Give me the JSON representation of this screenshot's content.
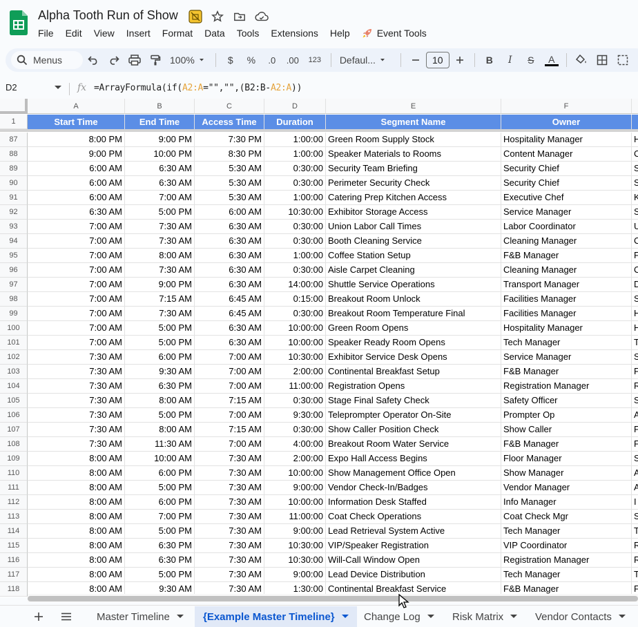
{
  "doc": {
    "title": "Alpha Tooth Run of Show",
    "menus": [
      "File",
      "Edit",
      "View",
      "Insert",
      "Format",
      "Data",
      "Tools",
      "Extensions",
      "Help"
    ],
    "extension_menu": "Event Tools"
  },
  "toolbar": {
    "search_label": "Menus",
    "zoom": "100%",
    "currency": "$",
    "percent": "%",
    "dec_decrease": ".0",
    "dec_increase": ".00",
    "number_format": "123",
    "font": "Defaul...",
    "font_size": "10",
    "bold": "B",
    "italic": "I",
    "strike": "S",
    "text_color": "A"
  },
  "formula_bar": {
    "cell_ref": "D2",
    "fx": "fx",
    "formula_parts": [
      "=ArrayFormula(if(",
      "A2:A",
      "=\"\",\"\",(B2:B-",
      "A2:A",
      "))"
    ]
  },
  "grid": {
    "column_letters": [
      "A",
      "B",
      "C",
      "D",
      "E",
      "F"
    ],
    "header_row_number": "1",
    "headers": [
      "Start Time",
      "End Time",
      "Access Time",
      "Duration",
      "Segment Name",
      "Owner"
    ],
    "rows": [
      {
        "n": "87",
        "a": "8:00 PM",
        "b": "9:00 PM",
        "c": "7:30 PM",
        "d": "1:00:00",
        "e": "Green Room Supply Stock",
        "f": "Hospitality Manager",
        "g": "H"
      },
      {
        "n": "88",
        "a": "9:00 PM",
        "b": "10:00 PM",
        "c": "8:30 PM",
        "d": "1:00:00",
        "e": "Speaker Materials to Rooms",
        "f": "Content Manager",
        "g": "C"
      },
      {
        "n": "89",
        "a": "6:00 AM",
        "b": "6:30 AM",
        "c": "5:30 AM",
        "d": "0:30:00",
        "e": "Security Team Briefing",
        "f": "Security Chief",
        "g": "S"
      },
      {
        "n": "90",
        "a": "6:00 AM",
        "b": "6:30 AM",
        "c": "5:30 AM",
        "d": "0:30:00",
        "e": "Perimeter Security Check",
        "f": "Security Chief",
        "g": "S"
      },
      {
        "n": "91",
        "a": "6:00 AM",
        "b": "7:00 AM",
        "c": "5:30 AM",
        "d": "1:00:00",
        "e": "Catering Prep Kitchen Access",
        "f": "Executive Chef",
        "g": "K"
      },
      {
        "n": "92",
        "a": "6:30 AM",
        "b": "5:00 PM",
        "c": "6:00 AM",
        "d": "10:30:00",
        "e": "Exhibitor Storage Access",
        "f": "Service Manager",
        "g": "S"
      },
      {
        "n": "93",
        "a": "7:00 AM",
        "b": "7:30 AM",
        "c": "6:30 AM",
        "d": "0:30:00",
        "e": "Union Labor Call Times",
        "f": "Labor Coordinator",
        "g": "U"
      },
      {
        "n": "94",
        "a": "7:00 AM",
        "b": "7:30 AM",
        "c": "6:30 AM",
        "d": "0:30:00",
        "e": "Booth Cleaning Service",
        "f": "Cleaning Manager",
        "g": "C"
      },
      {
        "n": "95",
        "a": "7:00 AM",
        "b": "8:00 AM",
        "c": "6:30 AM",
        "d": "1:00:00",
        "e": "Coffee Station Setup",
        "f": "F&B Manager",
        "g": "F"
      },
      {
        "n": "96",
        "a": "7:00 AM",
        "b": "7:30 AM",
        "c": "6:30 AM",
        "d": "0:30:00",
        "e": "Aisle Carpet Cleaning",
        "f": "Cleaning Manager",
        "g": "C"
      },
      {
        "n": "97",
        "a": "7:00 AM",
        "b": "9:00 PM",
        "c": "6:30 AM",
        "d": "14:00:00",
        "e": "Shuttle Service Operations",
        "f": "Transport Manager",
        "g": "D"
      },
      {
        "n": "98",
        "a": "7:00 AM",
        "b": "7:15 AM",
        "c": "6:45 AM",
        "d": "0:15:00",
        "e": "Breakout Room Unlock",
        "f": "Facilities Manager",
        "g": "S"
      },
      {
        "n": "99",
        "a": "7:00 AM",
        "b": "7:30 AM",
        "c": "6:45 AM",
        "d": "0:30:00",
        "e": "Breakout Room Temperature Final",
        "f": "Facilities Manager",
        "g": "H"
      },
      {
        "n": "100",
        "a": "7:00 AM",
        "b": "5:00 PM",
        "c": "6:30 AM",
        "d": "10:00:00",
        "e": "Green Room Opens",
        "f": "Hospitality Manager",
        "g": "H"
      },
      {
        "n": "101",
        "a": "7:00 AM",
        "b": "5:00 PM",
        "c": "6:30 AM",
        "d": "10:00:00",
        "e": "Speaker Ready Room Opens",
        "f": "Tech Manager",
        "g": "T"
      },
      {
        "n": "102",
        "a": "7:30 AM",
        "b": "6:00 PM",
        "c": "7:00 AM",
        "d": "10:30:00",
        "e": "Exhibitor Service Desk Opens",
        "f": "Service Manager",
        "g": "S"
      },
      {
        "n": "103",
        "a": "7:30 AM",
        "b": "9:30 AM",
        "c": "7:00 AM",
        "d": "2:00:00",
        "e": "Continental Breakfast Setup",
        "f": "F&B Manager",
        "g": "F"
      },
      {
        "n": "104",
        "a": "7:30 AM",
        "b": "6:30 PM",
        "c": "7:00 AM",
        "d": "11:00:00",
        "e": "Registration Opens",
        "f": "Registration Manager",
        "g": "R"
      },
      {
        "n": "105",
        "a": "7:30 AM",
        "b": "8:00 AM",
        "c": "7:15 AM",
        "d": "0:30:00",
        "e": "Stage Final Safety Check",
        "f": "Safety Officer",
        "g": "S"
      },
      {
        "n": "106",
        "a": "7:30 AM",
        "b": "5:00 PM",
        "c": "7:00 AM",
        "d": "9:30:00",
        "e": "Teleprompter Operator On-Site",
        "f": "Prompter Op",
        "g": "A"
      },
      {
        "n": "107",
        "a": "7:30 AM",
        "b": "8:00 AM",
        "c": "7:15 AM",
        "d": "0:30:00",
        "e": "Show Caller Position Check",
        "f": "Show Caller",
        "g": "P"
      },
      {
        "n": "108",
        "a": "7:30 AM",
        "b": "11:30 AM",
        "c": "7:00 AM",
        "d": "4:00:00",
        "e": "Breakout Room Water Service",
        "f": "F&B Manager",
        "g": "F"
      },
      {
        "n": "109",
        "a": "8:00 AM",
        "b": "10:00 AM",
        "c": "7:30 AM",
        "d": "2:00:00",
        "e": "Expo Hall Access Begins",
        "f": "Floor Manager",
        "g": "S"
      },
      {
        "n": "110",
        "a": "8:00 AM",
        "b": "6:00 PM",
        "c": "7:30 AM",
        "d": "10:00:00",
        "e": "Show Management Office Open",
        "f": "Show Manager",
        "g": "A"
      },
      {
        "n": "111",
        "a": "8:00 AM",
        "b": "5:00 PM",
        "c": "7:30 AM",
        "d": "9:00:00",
        "e": "Vendor Check-In/Badges",
        "f": "Vendor Manager",
        "g": "A"
      },
      {
        "n": "112",
        "a": "8:00 AM",
        "b": "6:00 PM",
        "c": "7:30 AM",
        "d": "10:00:00",
        "e": "Information Desk Staffed",
        "f": "Info Manager",
        "g": "I"
      },
      {
        "n": "113",
        "a": "8:00 AM",
        "b": "7:00 PM",
        "c": "7:30 AM",
        "d": "11:00:00",
        "e": "Coat Check Operations",
        "f": "Coat Check Mgr",
        "g": "S"
      },
      {
        "n": "114",
        "a": "8:00 AM",
        "b": "5:00 PM",
        "c": "7:30 AM",
        "d": "9:00:00",
        "e": "Lead Retrieval System Active",
        "f": "Tech Manager",
        "g": "T"
      },
      {
        "n": "115",
        "a": "8:00 AM",
        "b": "6:30 PM",
        "c": "7:30 AM",
        "d": "10:30:00",
        "e": "VIP/Speaker Registration",
        "f": "VIP Coordinator",
        "g": "R"
      },
      {
        "n": "116",
        "a": "8:00 AM",
        "b": "6:30 PM",
        "c": "7:30 AM",
        "d": "10:30:00",
        "e": "Will-Call Window Open",
        "f": "Registration Manager",
        "g": "R"
      },
      {
        "n": "117",
        "a": "8:00 AM",
        "b": "5:00 PM",
        "c": "7:30 AM",
        "d": "9:00:00",
        "e": "Lead Device Distribution",
        "f": "Tech Manager",
        "g": "T"
      },
      {
        "n": "118",
        "a": "8:00 AM",
        "b": "9:30 AM",
        "c": "7:30 AM",
        "d": "1:30:00",
        "e": "Continental Breakfast Service",
        "f": "F&B Manager",
        "g": "F"
      }
    ]
  },
  "sheet_tabs": [
    {
      "label": "Master Timeline",
      "active": false
    },
    {
      "label": "{Example Master Timeline}",
      "active": true
    },
    {
      "label": "Change Log",
      "active": false
    },
    {
      "label": "Risk Matrix",
      "active": false
    },
    {
      "label": "Vendor Contacts",
      "active": false
    }
  ],
  "colors": {
    "header_fill": "#5b8ee6",
    "active_tab_text": "#0b57d0",
    "sheets_green": "#0f9d58",
    "formula_ref": "#e5a33b"
  }
}
